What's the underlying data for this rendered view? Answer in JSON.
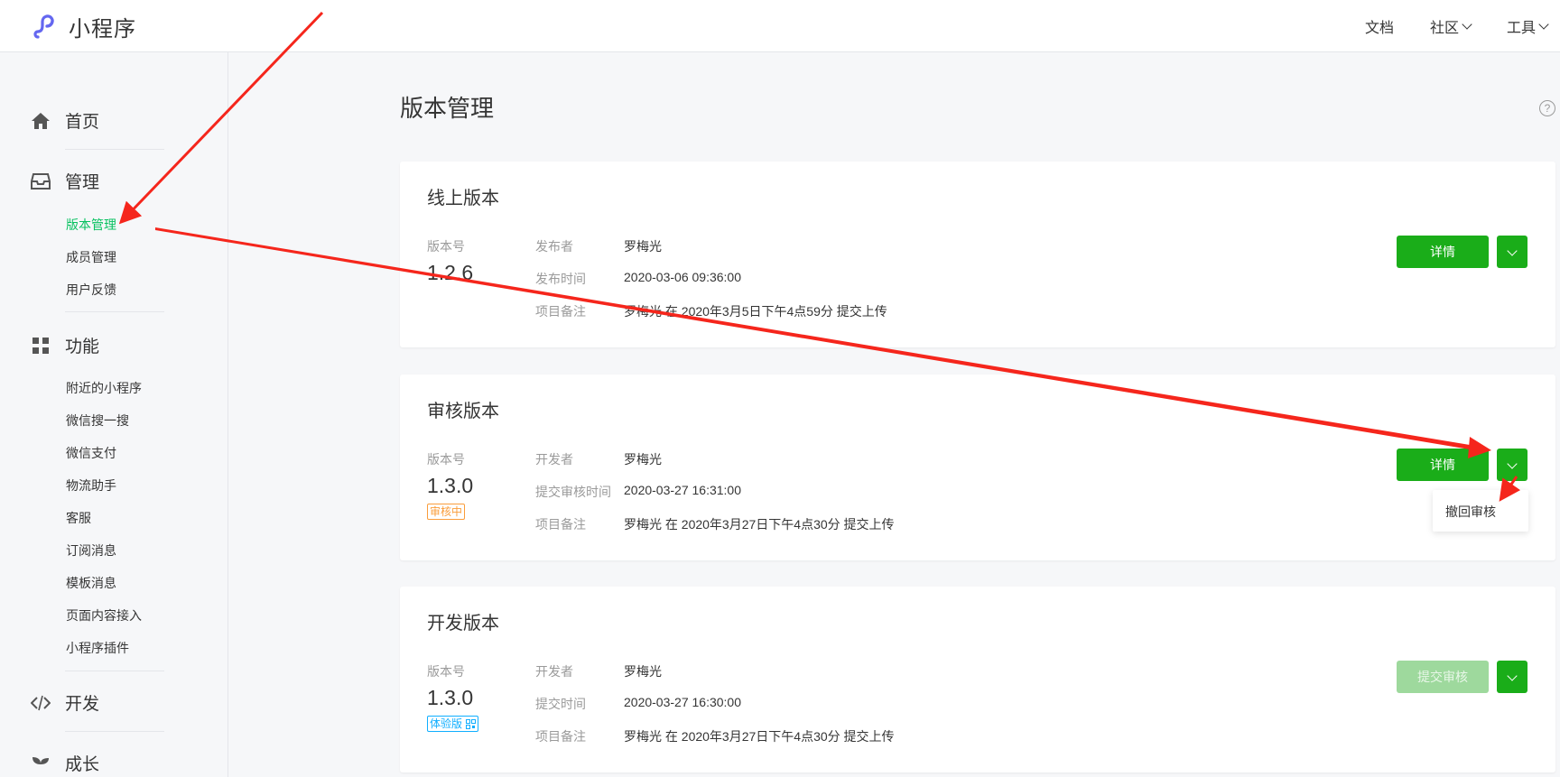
{
  "header": {
    "app_name": "小程序",
    "nav": [
      {
        "label": "文档",
        "dropdown": false
      },
      {
        "label": "社区",
        "dropdown": true
      },
      {
        "label": "工具",
        "dropdown": true
      }
    ]
  },
  "sidebar": {
    "home": "首页",
    "manage": {
      "label": "管理",
      "items": [
        "版本管理",
        "成员管理",
        "用户反馈"
      ]
    },
    "features": {
      "label": "功能",
      "items": [
        "附近的小程序",
        "微信搜一搜",
        "微信支付",
        "物流助手",
        "客服",
        "订阅消息",
        "模板消息",
        "页面内容接入",
        "小程序插件"
      ]
    },
    "develop": "开发",
    "growth": "成长",
    "active_item": "版本管理"
  },
  "main": {
    "title": "版本管理",
    "help": "?",
    "cards": [
      {
        "title": "线上版本",
        "version_label": "版本号",
        "version": "1.2.6",
        "fields": [
          {
            "key": "发布者",
            "value": "罗梅光"
          },
          {
            "key": "发布时间",
            "value": "2020-03-06 09:36:00"
          },
          {
            "key": "项目备注",
            "value": "罗梅光 在 2020年3月5日下午4点59分 提交上传"
          }
        ],
        "primary_button": "详情"
      },
      {
        "title": "审核版本",
        "version_label": "版本号",
        "version": "1.3.0",
        "tag": "审核中",
        "fields": [
          {
            "key": "开发者",
            "value": "罗梅光"
          },
          {
            "key": "提交审核时间",
            "value": "2020-03-27 16:31:00"
          },
          {
            "key": "项目备注",
            "value": "罗梅光 在 2020年3月27日下午4点30分 提交上传"
          }
        ],
        "primary_button": "详情",
        "dropdown_menu": [
          "撤回审核"
        ]
      },
      {
        "title": "开发版本",
        "version_label": "版本号",
        "version": "1.3.0",
        "tag": "体验版",
        "fields": [
          {
            "key": "开发者",
            "value": "罗梅光"
          },
          {
            "key": "提交时间",
            "value": "2020-03-27 16:30:00"
          },
          {
            "key": "项目备注",
            "value": "罗梅光 在 2020年3月27日下午4点30分 提交上传"
          }
        ],
        "primary_button": "提交审核",
        "primary_disabled": true
      }
    ]
  },
  "colors": {
    "brand_green": "#1aad19",
    "active_green": "#07c160",
    "review_orange": "#fa9d3b",
    "trial_blue": "#10aeff",
    "annotation_red": "#f5261c"
  }
}
